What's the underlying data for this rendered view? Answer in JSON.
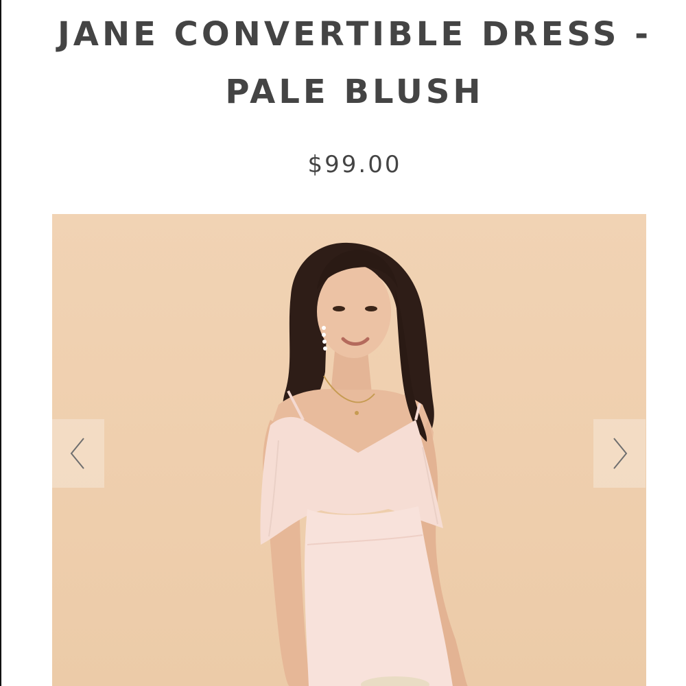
{
  "product": {
    "title": "JANE CONVERTIBLE DRESS - PALE BLUSH",
    "price": "$99.00"
  },
  "gallery": {
    "background_color": "#efcfae",
    "dress_color": "#f8e2db",
    "prev_icon": "chevron-left-icon",
    "next_icon": "chevron-right-icon"
  },
  "colors": {
    "text": "#444444",
    "background": "#ffffff"
  }
}
